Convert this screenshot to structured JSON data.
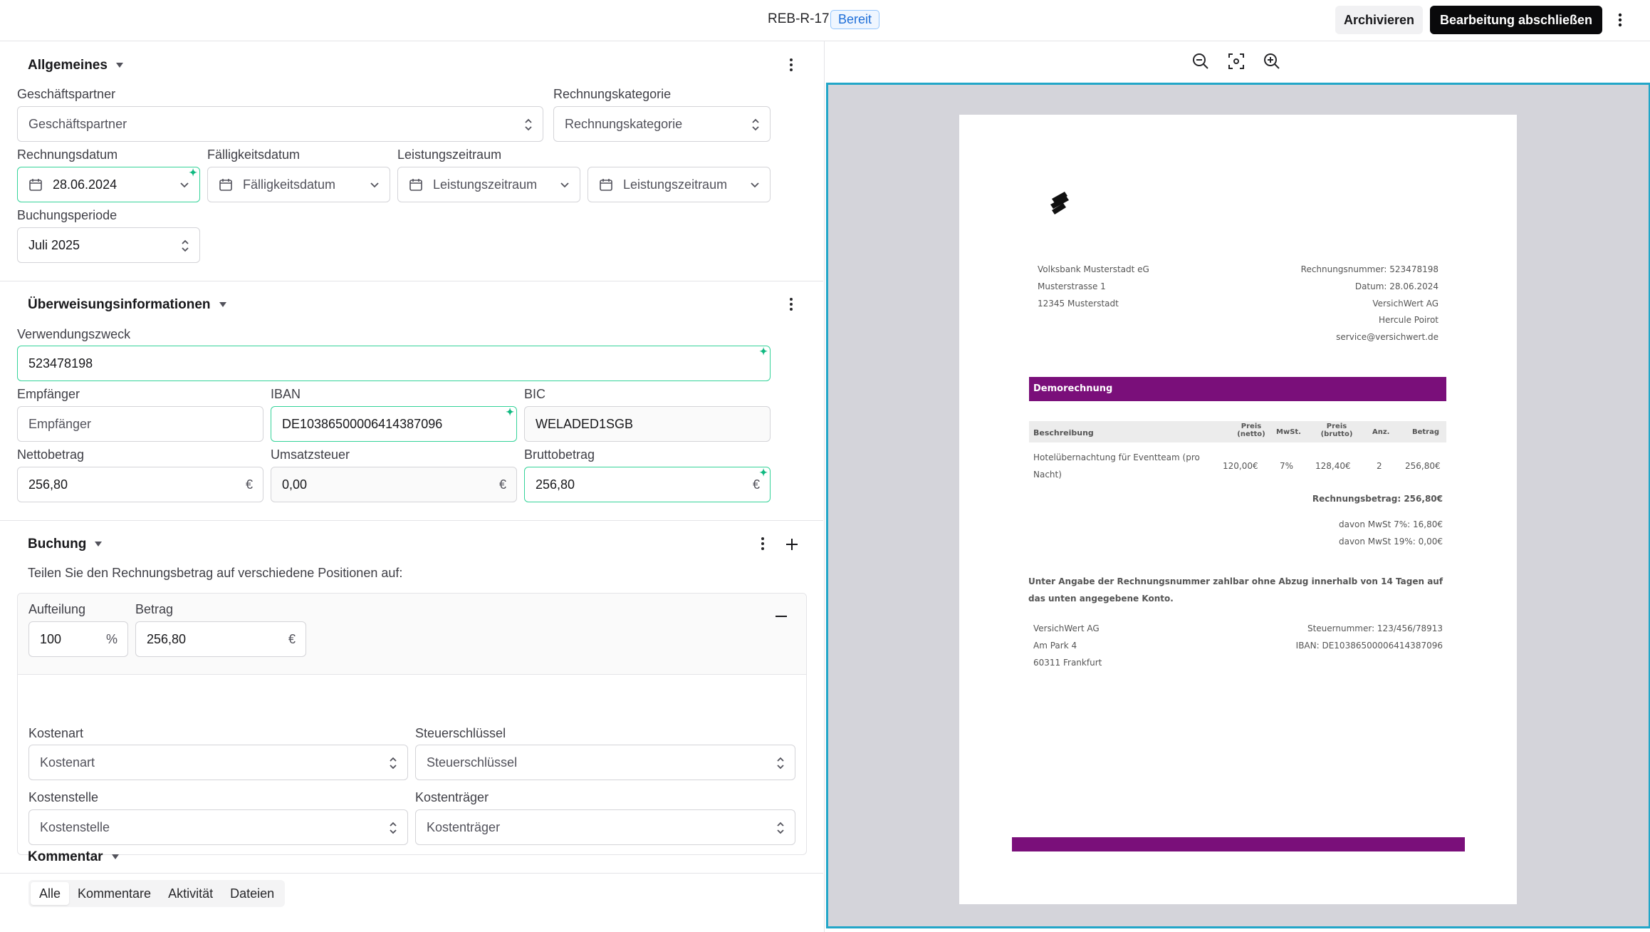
{
  "header": {
    "doc_id": "REB-R-17",
    "status": "Bereit",
    "archive_label": "Archivieren",
    "finish_label": "Bearbeitung abschließen"
  },
  "allgemeines": {
    "title": "Allgemeines",
    "partner_label": "Geschäftspartner",
    "partner_placeholder": "Geschäftspartner",
    "category_label": "Rechnungskategorie",
    "category_placeholder": "Rechnungskategorie",
    "invoice_date_label": "Rechnungsdatum",
    "invoice_date_value": "28.06.2024",
    "due_date_label": "Fälligkeitsdatum",
    "due_date_placeholder": "Fälligkeitsdatum",
    "period_label": "Leistungszeitraum",
    "period_from_placeholder": "Leistungszeitraum",
    "period_to_placeholder": "Leistungszeitraum",
    "booking_period_label": "Buchungsperiode",
    "booking_period_value": "Juli 2025"
  },
  "ueberweisung": {
    "title": "Überweisungsinformationen",
    "purpose_label": "Verwendungszweck",
    "purpose_value": "523478198",
    "recipient_label": "Empfänger",
    "recipient_placeholder": "Empfänger",
    "iban_label": "IBAN",
    "iban_value": "DE10386500006414387096",
    "bic_label": "BIC",
    "bic_value": "WELADED1SGB",
    "net_label": "Nettobetrag",
    "net_value": "256,80",
    "vat_label": "Umsatzsteuer",
    "vat_value": "0,00",
    "gross_label": "Bruttobetrag",
    "gross_value": "256,80",
    "currency": "€"
  },
  "buchung": {
    "title": "Buchung",
    "description": "Teilen Sie den Rechnungsbetrag auf verschiedene Positionen auf:",
    "split_label": "Aufteilung",
    "split_value": "100",
    "split_unit": "%",
    "amount_label": "Betrag",
    "amount_value": "256,80",
    "amount_unit": "€",
    "cost_type_label": "Kostenart",
    "cost_type_placeholder": "Kostenart",
    "tax_key_label": "Steuerschlüssel",
    "tax_key_placeholder": "Steuerschlüssel",
    "cost_center_label": "Kostenstelle",
    "cost_center_placeholder": "Kostenstelle",
    "cost_unit_label": "Kostenträger",
    "cost_unit_placeholder": "Kostenträger"
  },
  "kommentar": {
    "title": "Kommentar",
    "tabs": [
      "Alle",
      "Kommentare",
      "Aktivität",
      "Dateien"
    ]
  },
  "document": {
    "sender_1": "Volksbank Musterstadt eG",
    "sender_2": "Musterstrasse 1",
    "sender_3": "12345 Musterstadt",
    "meta_1": "Rechnungsnummer: 523478198",
    "meta_2": "Datum: 28.06.2024",
    "meta_3": "VersichWert AG",
    "meta_4": "Hercule Poirot",
    "meta_5": "service@versichwert.de",
    "heading": "Demorechnung",
    "col_desc": "Beschreibung",
    "col_net_1": "Preis",
    "col_net_2": "(netto)",
    "col_vat": "MwSt.",
    "col_gross_1": "Preis",
    "col_gross_2": "(brutto)",
    "col_qty": "Anz.",
    "col_total": "Betrag",
    "row_desc_1": "Hotelübernachtung für Eventteam (pro",
    "row_desc_2": "Nacht)",
    "row_net": "120,00€",
    "row_vat": "7%",
    "row_gross": "128,40€",
    "row_qty": "2",
    "row_total": "256,80€",
    "sum": "Rechnungsbetrag: 256,80€",
    "vat7": "davon MwSt 7%: 16,80€",
    "vat19": "davon MwSt 19%: 0,00€",
    "note_1": "Unter Angabe der Rechnungsnummer zahlbar ohne Abzug innerhalb von 14 Tagen auf",
    "note_2": "das unten angegebene Konto.",
    "footer_1": "VersichWert AG",
    "footer_2": "Am Park 4",
    "footer_3": "60311 Frankfurt",
    "footer_tax": "Steuernummer: 123/456/78913",
    "footer_iban": "IBAN: DE10386500006414387096"
  },
  "colors": {
    "accent": "#22a6c8",
    "brand_purple": "#7a0f7a",
    "ai_green": "#10b981"
  }
}
